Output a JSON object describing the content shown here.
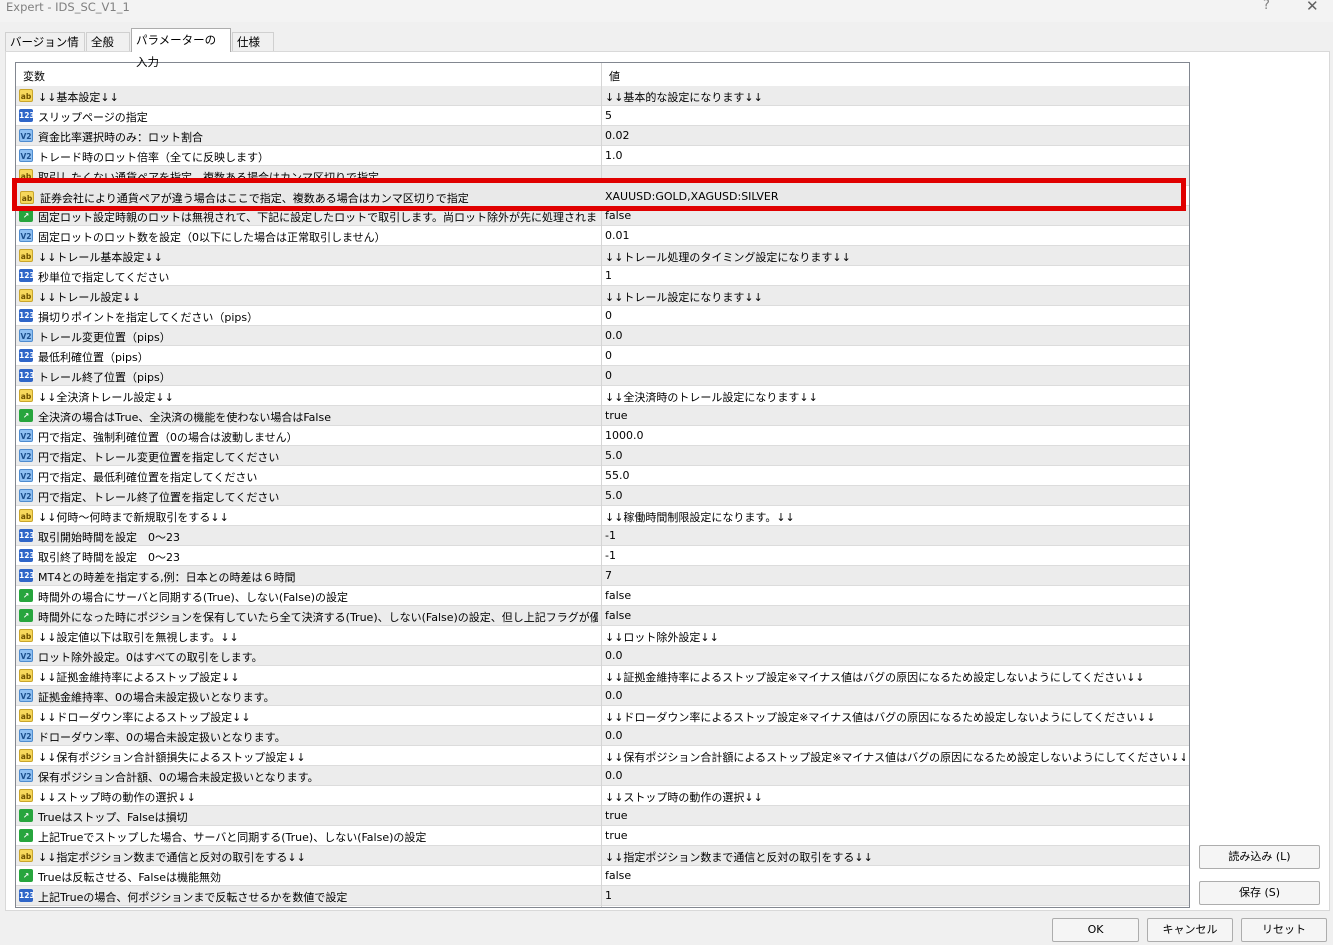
{
  "window": {
    "title": "Expert - IDS_SC_V1_1",
    "help": "?",
    "close": "✕"
  },
  "tabs": [
    "バージョン情報",
    "全般",
    "パラメーターの入力",
    "仕様"
  ],
  "grid": {
    "col_variable": "変数",
    "col_value": "値",
    "rows": [
      {
        "icon": "ab",
        "name": "↓↓基本設定↓↓",
        "value": "↓↓基本的な設定になります↓↓"
      },
      {
        "icon": "123",
        "name": "スリップページの指定",
        "value": "5"
      },
      {
        "icon": "v2",
        "name": "資金比率選択時のみ：ロット割合",
        "value": "0.02"
      },
      {
        "icon": "v2",
        "name": "トレード時のロット倍率（全てに反映します）",
        "value": "1.0"
      },
      {
        "icon": "ab",
        "name": "取引したくない通貨ペアを指定、複数ある場合はカンマ区切りで指定",
        "value": ""
      },
      {
        "icon": "ab",
        "name": "証券会社により通貨ペアが違う場合はここで指定、複数ある場合はカンマ区切りで指定",
        "value": "XAUUSD:GOLD,XAGUSD:SILVER"
      },
      {
        "icon": "bool",
        "name": "固定ロット設定時親のロットは無視されて、下記に設定したロットで取引します。尚ロット除外が先に処理されます。",
        "value": "false"
      },
      {
        "icon": "v2",
        "name": "固定ロットのロット数を設定（0以下にした場合は正常取引しません）",
        "value": "0.01"
      },
      {
        "icon": "ab",
        "name": "↓↓トレール基本設定↓↓",
        "value": "↓↓トレール処理のタイミング設定になります↓↓"
      },
      {
        "icon": "123",
        "name": "秒単位で指定してください",
        "value": "1"
      },
      {
        "icon": "ab",
        "name": "↓↓トレール設定↓↓",
        "value": "↓↓トレール設定になります↓↓"
      },
      {
        "icon": "123",
        "name": "損切りポイントを指定してください（pips）",
        "value": "0"
      },
      {
        "icon": "v2",
        "name": "トレール変更位置（pips）",
        "value": "0.0"
      },
      {
        "icon": "123",
        "name": "最低利確位置（pips）",
        "value": "0"
      },
      {
        "icon": "123",
        "name": "トレール終了位置（pips）",
        "value": "0"
      },
      {
        "icon": "ab",
        "name": "↓↓全決済トレール設定↓↓",
        "value": "↓↓全決済時のトレール設定になります↓↓"
      },
      {
        "icon": "bool",
        "name": "全決済の場合はTrue、全決済の機能を使わない場合はFalse",
        "value": "true"
      },
      {
        "icon": "v2",
        "name": "円で指定、強制利確位置（0の場合は波動しません）",
        "value": "1000.0"
      },
      {
        "icon": "v2",
        "name": "円で指定、トレール変更位置を指定してください",
        "value": "5.0"
      },
      {
        "icon": "v2",
        "name": "円で指定、最低利確位置を指定してください",
        "value": "55.0"
      },
      {
        "icon": "v2",
        "name": "円で指定、トレール終了位置を指定してください",
        "value": "5.0"
      },
      {
        "icon": "ab",
        "name": "↓↓何時〜何時まで新規取引をする↓↓",
        "value": "↓↓稼働時間制限設定になります。↓↓"
      },
      {
        "icon": "123",
        "name": "取引開始時間を設定　0〜23",
        "value": "-1"
      },
      {
        "icon": "123",
        "name": "取引終了時間を設定　0〜23",
        "value": "-1"
      },
      {
        "icon": "123",
        "name": "MT4との時差を指定する,例：日本との時差は６時間",
        "value": "7"
      },
      {
        "icon": "bool",
        "name": "時間外の場合にサーバと同期する(True)、しない(False)の設定",
        "value": "false"
      },
      {
        "icon": "bool",
        "name": "時間外になった時にポジションを保有していたら全て決済する(True)、しない(False)の設定、但し上記フラグが優先され…",
        "value": "false"
      },
      {
        "icon": "ab",
        "name": "↓↓設定値以下は取引を無視します。↓↓",
        "value": "↓↓ロット除外設定↓↓"
      },
      {
        "icon": "v2",
        "name": "ロット除外設定。0はすべての取引をします。",
        "value": "0.0"
      },
      {
        "icon": "ab",
        "name": "↓↓証拠金維持率によるストップ設定↓↓",
        "value": "↓↓証拠金維持率によるストップ設定※マイナス値はバグの原因になるため設定しないようにしてください↓↓"
      },
      {
        "icon": "v2",
        "name": "証拠金維持率、0の場合未設定扱いとなります。",
        "value": "0.0"
      },
      {
        "icon": "ab",
        "name": "↓↓ドローダウン率によるストップ設定↓↓",
        "value": "↓↓ドローダウン率によるストップ設定※マイナス値はバグの原因になるため設定しないようにしてください↓↓"
      },
      {
        "icon": "v2",
        "name": "ドローダウン率、0の場合未設定扱いとなります。",
        "value": "0.0"
      },
      {
        "icon": "ab",
        "name": "↓↓保有ポジション合計額損失によるストップ設定↓↓",
        "value": "↓↓保有ポジション合計額によるストップ設定※マイナス値はバグの原因になるため設定しないようにしてください↓↓"
      },
      {
        "icon": "v2",
        "name": "保有ポジション合計額、0の場合未設定扱いとなります。",
        "value": "0.0"
      },
      {
        "icon": "ab",
        "name": "↓↓ストップ時の動作の選択↓↓",
        "value": "↓↓ストップ時の動作の選択↓↓"
      },
      {
        "icon": "bool",
        "name": "Trueはストップ、Falseは損切",
        "value": "true"
      },
      {
        "icon": "bool",
        "name": "上記Trueでストップした場合、サーバと同期する(True)、しない(False)の設定",
        "value": "true"
      },
      {
        "icon": "ab",
        "name": "↓↓指定ポジション数まで通信と反対の取引をする↓↓",
        "value": "↓↓指定ポジション数まで通信と反対の取引をする↓↓"
      },
      {
        "icon": "bool",
        "name": "Trueは反転させる、Falseは機能無効",
        "value": "false"
      },
      {
        "icon": "123",
        "name": "上記Trueの場合、何ポジションまで反転させるかを数値で設定",
        "value": "1"
      }
    ]
  },
  "highlight": {
    "name": "証券会社により通貨ペアが違う場合はここで指定、複数ある場合はカンマ区切りで指定",
    "value": "XAUUSD:GOLD,XAGUSD:SILVER"
  },
  "icon_labels": {
    "ab": "ab",
    "123": "123",
    "v2": "V2",
    "bool": "↗"
  },
  "buttons": {
    "load": "読み込み (L)",
    "save": "保存 (S)",
    "ok": "OK",
    "cancel": "キャンセル",
    "reset": "リセット"
  },
  "colors": {
    "highlight_border": "#e00000"
  }
}
